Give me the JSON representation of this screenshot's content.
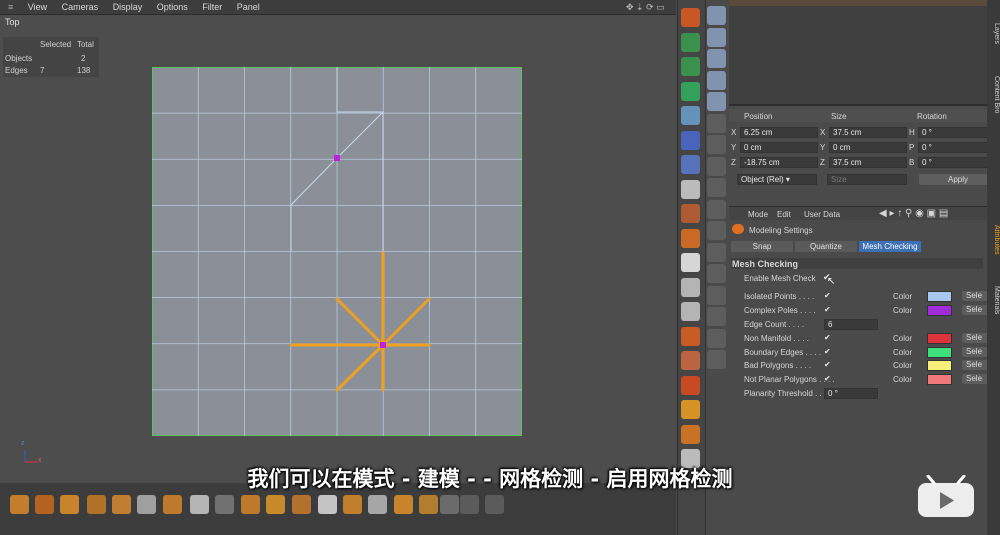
{
  "menu": [
    "View",
    "Cameras",
    "Display",
    "Options",
    "Filter",
    "Panel"
  ],
  "viewport": {
    "label": "Top",
    "stats": {
      "col_selected": "Selected",
      "col_total": "Total",
      "rows": [
        {
          "name": "Objects",
          "selected": "",
          "total": "2"
        },
        {
          "name": "Edges",
          "selected": "7",
          "total": "138"
        }
      ]
    },
    "axis_x": "x",
    "axis_z": "z"
  },
  "coords": {
    "headers": [
      "Position",
      "Size",
      "Rotation"
    ],
    "rows": [
      {
        "pl": "X",
        "pv": "6.25 cm",
        "sl": "X",
        "sv": "37.5 cm",
        "rl": "H",
        "rv": "0 °"
      },
      {
        "pl": "Y",
        "pv": "0 cm",
        "sl": "Y",
        "sv": "0 cm",
        "rl": "P",
        "rv": "0 °"
      },
      {
        "pl": "Z",
        "pv": "-18.75 cm",
        "sl": "Z",
        "sv": "37.5 cm",
        "rl": "B",
        "rv": "0 °"
      }
    ],
    "mode_select": "Object (Rel)",
    "size_select": "Size",
    "apply": "Apply"
  },
  "attributes": {
    "menu": [
      "Mode",
      "Edit",
      "User Data"
    ],
    "title": "Modeling Settings",
    "tabs": [
      "Snap",
      "Quantize",
      "Mesh Checking"
    ],
    "section": "Mesh Checking",
    "enable": "Enable Mesh Check",
    "rows": [
      {
        "label": "Isolated Points",
        "checked": true,
        "color": "#a9c8f0"
      },
      {
        "label": "Complex Poles",
        "checked": true,
        "color": "#a22bdc"
      },
      {
        "label": "Edge Count",
        "value": "6"
      },
      {
        "label": "Non Manifold",
        "checked": true,
        "color": "#e0343c"
      },
      {
        "label": "Boundary Edges",
        "checked": true,
        "color": "#3de07a"
      },
      {
        "label": "Bad Polygons",
        "checked": true,
        "color": "#f6f07a"
      },
      {
        "label": "Not Planar Polygons",
        "checked": true,
        "color": "#f07a7a"
      },
      {
        "label": "Planarity Threshold",
        "value": "0 °"
      }
    ],
    "color_label": "Color",
    "select_label": "Sele"
  },
  "side_tabs": [
    "Layers",
    "Content Bro",
    "Attributes",
    "Materials"
  ],
  "subtitle": "我们可以在模式 - 建模 - - 网格检测 - 启用网格检测",
  "colors": {
    "grid_bg": "#8b8f98",
    "accent": "#f0a020",
    "vertex": "#c020e0"
  }
}
